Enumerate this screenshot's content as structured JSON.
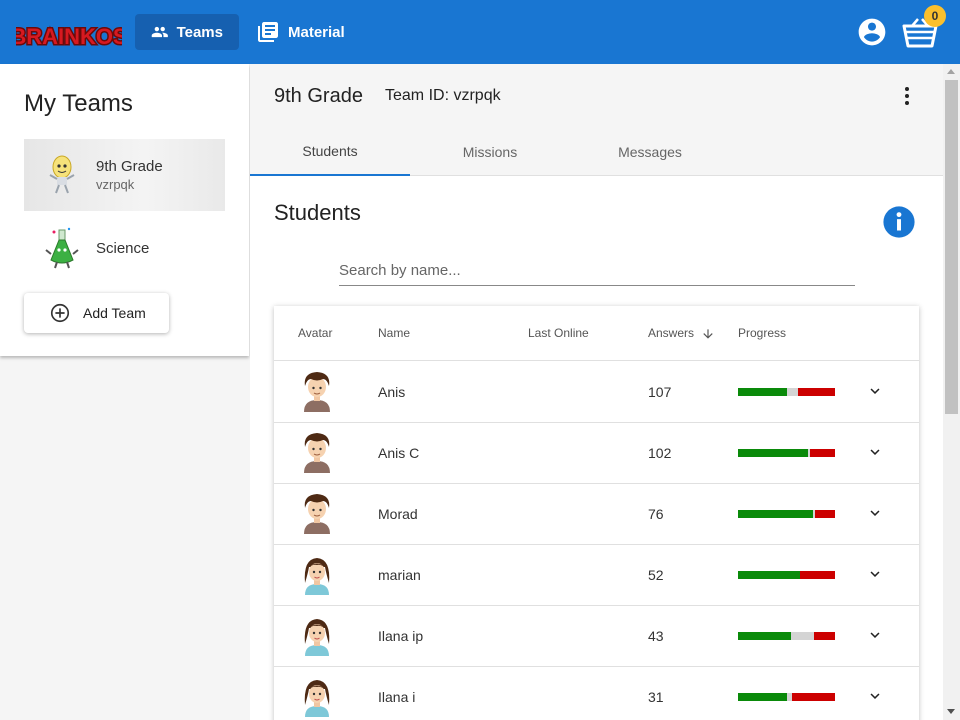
{
  "topbar": {
    "logo_text": "BRAINKOS",
    "nav": [
      {
        "label": "Teams",
        "icon": "people-icon"
      },
      {
        "label": "Material",
        "icon": "library-books-icon"
      }
    ],
    "cart_count": "0"
  },
  "left": {
    "title": "My Teams",
    "teams": [
      {
        "name": "9th Grade",
        "code": "vzrpqk"
      },
      {
        "name": "Science",
        "code": ""
      }
    ],
    "add_label": "Add Team"
  },
  "main": {
    "title": "9th Grade",
    "team_id": "Team ID: vzrpqk",
    "tabs": [
      "Students",
      "Missions",
      "Messages"
    ],
    "section_title": "Students",
    "search_placeholder": "Search by name...",
    "columns": [
      "Avatar",
      "Name",
      "Last Online",
      "Answers",
      "Progress"
    ],
    "students": [
      {
        "name": "Anis",
        "last_online": "",
        "answers": "107",
        "avatar": "boy",
        "progress": {
          "correct": 0.5,
          "neutral": 0.12,
          "wrong": 0.38
        }
      },
      {
        "name": "Anis C",
        "last_online": "",
        "answers": "102",
        "avatar": "boy",
        "progress": {
          "correct": 0.72,
          "neutral": 0.02,
          "wrong": 0.26
        }
      },
      {
        "name": "Morad",
        "last_online": "",
        "answers": "76",
        "avatar": "boy",
        "progress": {
          "correct": 0.77,
          "neutral": 0.02,
          "wrong": 0.21
        }
      },
      {
        "name": "marian",
        "last_online": "",
        "answers": "52",
        "avatar": "girl",
        "progress": {
          "correct": 0.64,
          "neutral": 0.0,
          "wrong": 0.36
        }
      },
      {
        "name": "Ilana ip",
        "last_online": "",
        "answers": "43",
        "avatar": "girl",
        "progress": {
          "correct": 0.55,
          "neutral": 0.23,
          "wrong": 0.22
        }
      },
      {
        "name": "Ilana i",
        "last_online": "",
        "answers": "31",
        "avatar": "girl",
        "progress": {
          "correct": 0.5,
          "neutral": 0.06,
          "wrong": 0.44
        }
      }
    ]
  },
  "colors": {
    "primary": "#1976d2",
    "correct": "#0a8a0a",
    "neutral": "#d4d4d4",
    "wrong": "#cc0000",
    "badge": "#fbc02d"
  }
}
